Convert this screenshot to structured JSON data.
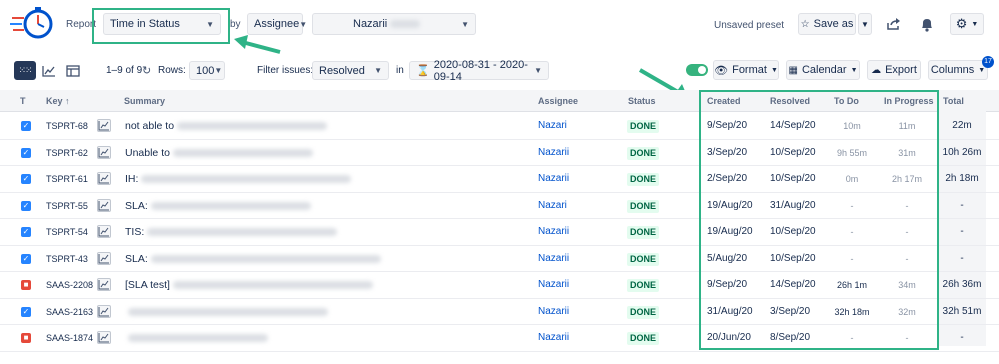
{
  "header": {
    "report_label": "Report",
    "report_value": "Time in Status",
    "by_label": "by",
    "groupby_value": "Assignee",
    "user_value": "Nazarii",
    "unsaved_label": "Unsaved preset",
    "save_as_label": "Save as"
  },
  "toolbar": {
    "count_label": "1–9 of 9",
    "rows_label": "Rows:",
    "rows_value": "100",
    "filter_label": "Filter issues:",
    "filter_value": "Resolved",
    "in_label": "in",
    "date_range": "2020-08-31 - 2020-09-14",
    "format_label": "Format",
    "calendar_label": "Calendar",
    "export_label": "Export",
    "columns_label": "Columns",
    "columns_badge": "17"
  },
  "table": {
    "headers": {
      "t": "T",
      "key": "Key",
      "summary": "Summary",
      "assignee": "Assignee",
      "status": "Status",
      "created": "Created",
      "resolved": "Resolved",
      "todo": "To Do",
      "inprogress": "In Progress",
      "total": "Total"
    },
    "rows": [
      {
        "key": "TSPRT-68",
        "type": "task",
        "summary": "not able to",
        "assignee": "Nazari",
        "status": "DONE",
        "created": "9/Sep/20",
        "resolved": "14/Sep/20",
        "todo": "10m",
        "inprogress": "11m",
        "total": "22m"
      },
      {
        "key": "TSPRT-62",
        "type": "task",
        "summary": "Unable to",
        "assignee": "Nazarii",
        "status": "DONE",
        "created": "3/Sep/20",
        "resolved": "10/Sep/20",
        "todo": "9h 55m",
        "inprogress": "31m",
        "total": "10h 26m"
      },
      {
        "key": "TSPRT-61",
        "type": "task",
        "summary": "IH:",
        "assignee": "Nazarii",
        "status": "DONE",
        "created": "2/Sep/20",
        "resolved": "10/Sep/20",
        "todo": "0m",
        "inprogress": "2h 17m",
        "total": "2h 18m"
      },
      {
        "key": "TSPRT-55",
        "type": "task",
        "summary": "SLA:",
        "assignee": "Nazari",
        "status": "DONE",
        "created": "19/Aug/20",
        "resolved": "31/Aug/20",
        "todo": "-",
        "inprogress": "-",
        "total": "-"
      },
      {
        "key": "TSPRT-54",
        "type": "task",
        "summary": "TIS:",
        "assignee": "Nazarii",
        "status": "DONE",
        "created": "19/Aug/20",
        "resolved": "10/Sep/20",
        "todo": "-",
        "inprogress": "-",
        "total": "-"
      },
      {
        "key": "TSPRT-43",
        "type": "task",
        "summary": "SLA:",
        "assignee": "Nazarii",
        "status": "DONE",
        "created": "5/Aug/20",
        "resolved": "10/Sep/20",
        "todo": "-",
        "inprogress": "-",
        "total": "-"
      },
      {
        "key": "SAAS-2208",
        "type": "bug",
        "summary": "[SLA test]",
        "assignee": "Nazarii",
        "status": "DONE",
        "created": "9/Sep/20",
        "resolved": "14/Sep/20",
        "todo": "26h 1m",
        "inprogress": "34m",
        "total": "26h 36m"
      },
      {
        "key": "SAAS-2163",
        "type": "task",
        "summary": "",
        "assignee": "Nazarii",
        "status": "DONE",
        "created": "31/Aug/20",
        "resolved": "3/Sep/20",
        "todo": "32h 18m",
        "inprogress": "32m",
        "total": "32h 51m"
      },
      {
        "key": "SAAS-1874",
        "type": "bug",
        "summary": "",
        "assignee": "Nazarii",
        "status": "DONE",
        "created": "20/Jun/20",
        "resolved": "8/Sep/20",
        "todo": "-",
        "inprogress": "-",
        "total": "-"
      }
    ]
  },
  "colors": {
    "accent": "#2684ff",
    "highlight": "#2fb387",
    "done_text": "#006644",
    "done_bg": "#e3fcef",
    "bug": "#e5493a"
  },
  "icons": [
    "clock-logo-icon",
    "chevron-down-icon",
    "star-icon",
    "share-icon",
    "bell-icon",
    "gear-icon",
    "grid-view-icon",
    "chart-view-icon",
    "table-view-icon",
    "refresh-icon",
    "toggle-icon",
    "eye-icon",
    "calendar-icon",
    "cloud-download-icon",
    "chart-icon",
    "checkbox-icon",
    "bug-icon",
    "arrow-icon"
  ]
}
